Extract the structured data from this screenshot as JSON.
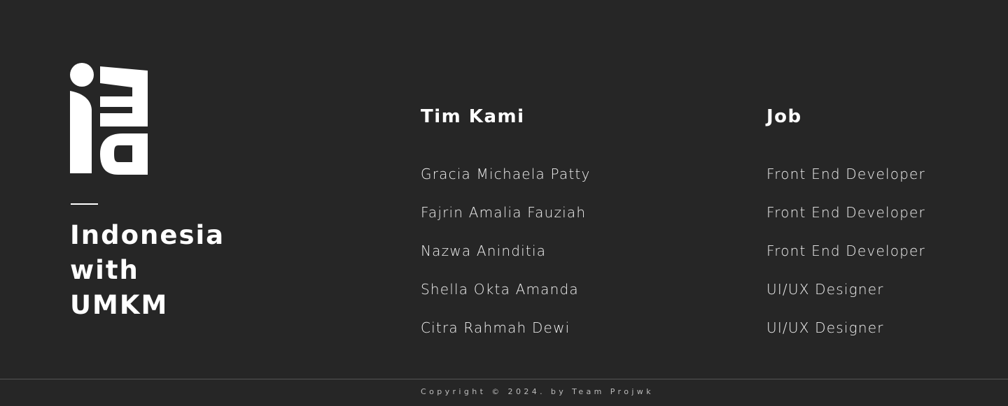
{
  "brand": {
    "logo_icon": "iwu-logo",
    "title_lines": [
      "Indonesia",
      "with",
      "UMKM"
    ]
  },
  "team": {
    "heading": "Tim Kami",
    "members": [
      "Gracia Michaela Patty",
      "Fajrin Amalia Fauziah",
      "Nazwa Aninditia",
      "Shella Okta Amanda",
      "Citra Rahmah Dewi"
    ]
  },
  "job": {
    "heading": "Job",
    "roles": [
      "Front End Developer",
      "Front End Developer",
      "Front End Developer",
      "UI/UX Designer",
      "UI/UX Designer"
    ]
  },
  "footer": {
    "copyright": "Copyright © 2024. by Team Projwk"
  },
  "colors": {
    "background": "#262626",
    "text": "#ffffff",
    "divider": "#555555"
  }
}
